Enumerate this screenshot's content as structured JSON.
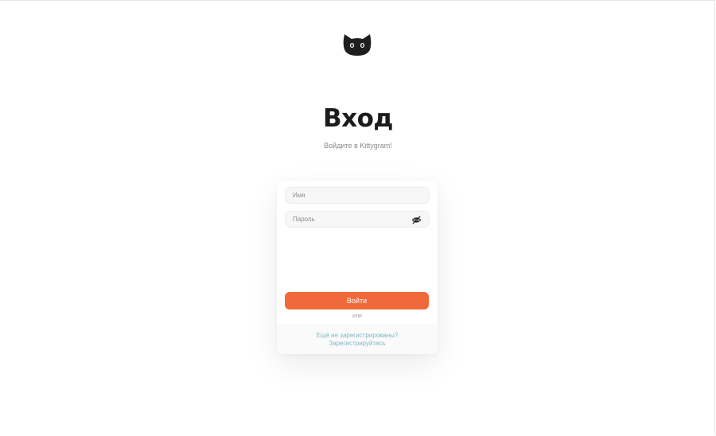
{
  "header": {
    "logo_icon": "cat-face-icon",
    "title": "Вход",
    "subtitle": "Войдите в Kittygram!"
  },
  "form": {
    "username_placeholder": "Имя",
    "username_value": "",
    "password_placeholder": "Пароль",
    "password_value": "",
    "password_toggle_icon": "eye-off-icon",
    "login_label": "Войти",
    "or_label": "или",
    "register_question": "Ещё не зарегистрированы?",
    "register_link": "Зарегистрируйтесь"
  },
  "colors": {
    "accent": "#f0693a",
    "link": "#7fb8c4",
    "title": "#1c1c1c"
  }
}
